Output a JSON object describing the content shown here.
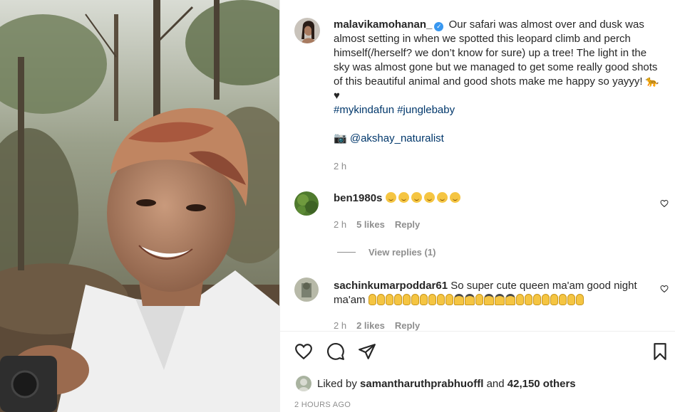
{
  "post": {
    "username": "malavikamohanan_",
    "verified_icon": "verified-badge-icon",
    "caption": "Our safari was almost over and dusk was almost setting in when we spotted this leopard climb and perch himself(/herself? we don’t know for sure) up a tree! The light in the sky was almost gone but we managed to get some really good shots of this beautiful animal and good shots make me happy so yayyy! 🐆♥",
    "hashtags": "#mykindafun #junglebaby",
    "camera_icon": "📷",
    "mention": "@akshay_naturalist",
    "time": "2 h"
  },
  "comments": [
    {
      "username": "ben1980s",
      "likes": "5 likes",
      "time": "2 h",
      "reply_label": "Reply",
      "view_replies": "View replies (1)"
    },
    {
      "username": "sachinkumarpoddar61",
      "text_start": "So super cute queen ma'am good night ma'am",
      "likes": "2 likes",
      "time": "2 h",
      "reply_label": "Reply"
    }
  ],
  "actions": {
    "like_icon": "heart-icon",
    "comment_icon": "comment-icon",
    "share_icon": "paper-plane-icon",
    "save_icon": "bookmark-icon"
  },
  "likes_summary": {
    "prefix": "Liked by",
    "user": "samantharuthprabhuoffl",
    "middle": "and",
    "count": "42,150 others"
  },
  "timestamp": "2 HOURS AGO"
}
